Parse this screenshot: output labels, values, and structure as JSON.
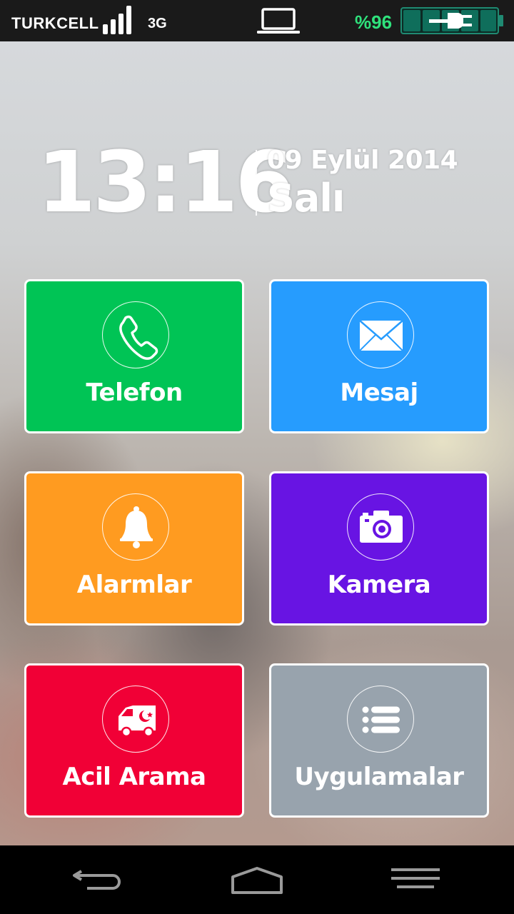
{
  "status_bar": {
    "carrier": "TURKCELL",
    "network": "3G",
    "battery_percent": "%96",
    "battery_level": 0.96,
    "icons": [
      "signal-icon",
      "laptop-icon",
      "battery-charging-icon"
    ],
    "colors": {
      "battery_text": "#2fe27c",
      "battery_fill": "#0f6e5b"
    }
  },
  "lockscreen": {
    "time": "13:16",
    "date": "09 Eylül 2014",
    "day": "Salı"
  },
  "tiles": [
    {
      "label": "Telefon",
      "icon": "phone-icon",
      "color": "#00c455"
    },
    {
      "label": "Mesaj",
      "icon": "envelope-icon",
      "color": "#269cfe"
    },
    {
      "label": "Alarmlar",
      "icon": "bell-icon",
      "color": "#ff9b20"
    },
    {
      "label": "Kamera",
      "icon": "camera-icon",
      "color": "#6814e3"
    },
    {
      "label": "Acil Arama",
      "icon": "ambulance-icon",
      "color": "#f10036"
    },
    {
      "label": "Uygulamalar",
      "icon": "list-icon",
      "color": "#98a3ad"
    }
  ],
  "nav_bar": {
    "icons": [
      "back-icon",
      "home-icon",
      "menu-icon"
    ]
  }
}
